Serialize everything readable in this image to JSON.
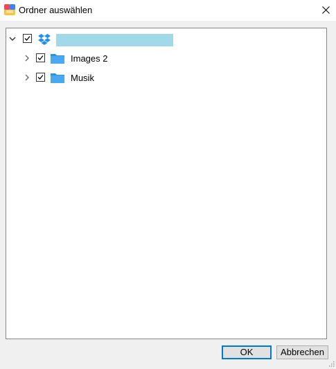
{
  "window": {
    "title": "Ordner auswählen",
    "app_icon": "app-icon",
    "close_icon": "close-icon"
  },
  "tree": {
    "root": {
      "icon": "dropbox-icon",
      "label_redacted": true,
      "checked": true,
      "expanded": true
    },
    "children": [
      {
        "label": "Images 2",
        "icon": "folder-icon",
        "checked": true,
        "expanded": false
      },
      {
        "label": "Musik",
        "icon": "folder-icon",
        "checked": true,
        "expanded": false
      }
    ]
  },
  "buttons": {
    "ok_label": "OK",
    "cancel_label": "Abbrechen"
  },
  "colors": {
    "accent": "#0078d7",
    "folder": "#4aa8f0",
    "dropbox": "#1f8ef1",
    "redaction": "#9fd9ea"
  }
}
